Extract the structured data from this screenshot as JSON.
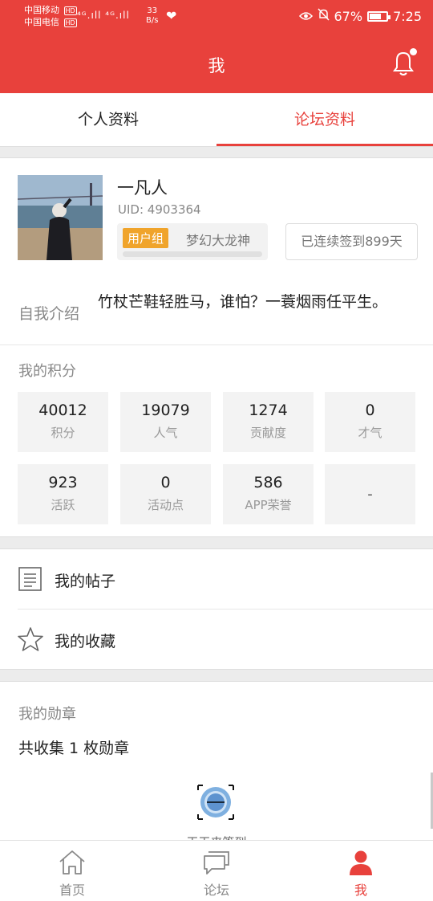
{
  "status_bar": {
    "carrier1": "中国移动",
    "carrier2": "中国电信",
    "hd": "HD",
    "signals": "⁴ᴳ.ıll ⁴ᴳ.ıll",
    "speed_value": "33",
    "speed_unit": "B/s",
    "battery": "67%",
    "time": "7:25"
  },
  "header": {
    "title": "我"
  },
  "tabs": [
    {
      "label": "个人资料",
      "active": false
    },
    {
      "label": "论坛资料",
      "active": true
    }
  ],
  "profile": {
    "username": "一凡人",
    "uid": "UID: 4903364",
    "group_tag": "用户组",
    "group_name": "梦幻大龙神",
    "group_progress": 0,
    "signin_text": "已连续签到899天",
    "bio_label": "自我介绍",
    "bio_text": "竹杖芒鞋轻胜马，谁怕？一蓑烟雨任平生。"
  },
  "scores": {
    "title": "我的积分",
    "items": [
      {
        "value": "40012",
        "label": "积分"
      },
      {
        "value": "19079",
        "label": "人气"
      },
      {
        "value": "1274",
        "label": "贡献度"
      },
      {
        "value": "0",
        "label": "才气"
      },
      {
        "value": "923",
        "label": "活跃"
      },
      {
        "value": "0",
        "label": "活动点"
      },
      {
        "value": "586",
        "label": "APP荣誉"
      },
      {
        "value": "-",
        "label": ""
      }
    ]
  },
  "menu": [
    {
      "label": "我的帖子",
      "icon": "document-icon"
    },
    {
      "label": "我的收藏",
      "icon": "star-icon"
    }
  ],
  "badges": {
    "title": "我的勋章",
    "count_text": "共收集 1 枚勋章",
    "items": [
      {
        "caption": "天天来签到"
      }
    ]
  },
  "bottom_nav": [
    {
      "label": "首页",
      "icon": "home-icon",
      "active": false
    },
    {
      "label": "论坛",
      "icon": "forum-icon",
      "active": false
    },
    {
      "label": "我",
      "icon": "person-icon",
      "active": true
    }
  ],
  "colors": {
    "accent": "#e8413c",
    "group_tag": "#f0a42b"
  }
}
